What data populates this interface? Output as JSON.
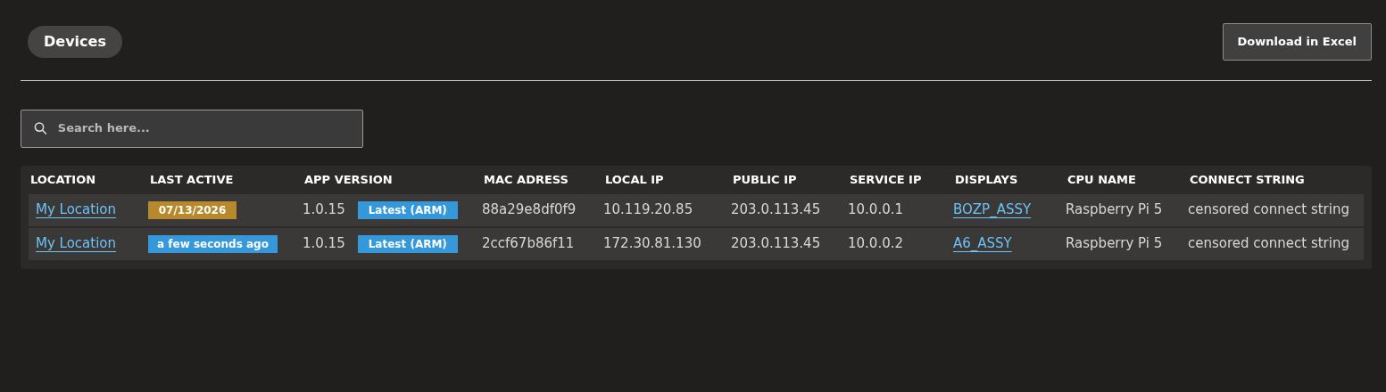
{
  "title": "Devices",
  "download_button": "Download in Excel",
  "search": {
    "placeholder": "Search here..."
  },
  "table": {
    "columns": [
      "LOCATION",
      "LAST ACTIVE",
      "APP VERSION",
      "MAC ADRESS",
      "LOCAL IP",
      "PUBLIC IP",
      "SERVICE IP",
      "DISPLAYS",
      "CPU NAME",
      "CONNECT STRING"
    ],
    "rows": [
      {
        "location": "My Location",
        "last_active": {
          "text": "07/13/2026",
          "color": "#b5892c"
        },
        "app_version": "1.0.15",
        "version_badge": "Latest (ARM)",
        "mac": "88a29e8df0f9",
        "local_ip": "10.119.20.85",
        "public_ip": "203.0.113.45",
        "service_ip": "10.0.0.1",
        "displays": "BOZP_ASSY",
        "cpu": "Raspberry Pi 5",
        "connect_string": "censored connect string"
      },
      {
        "location": "My Location",
        "last_active": {
          "text": "a few seconds ago",
          "color": "#3498db"
        },
        "app_version": "1.0.15",
        "version_badge": "Latest (ARM)",
        "mac": "2ccf67b86f11",
        "local_ip": "172.30.81.130",
        "public_ip": "203.0.113.45",
        "service_ip": "10.0.0.2",
        "displays": "A6_ASSY",
        "cpu": "Raspberry Pi 5",
        "connect_string": "censored connect string"
      }
    ]
  }
}
